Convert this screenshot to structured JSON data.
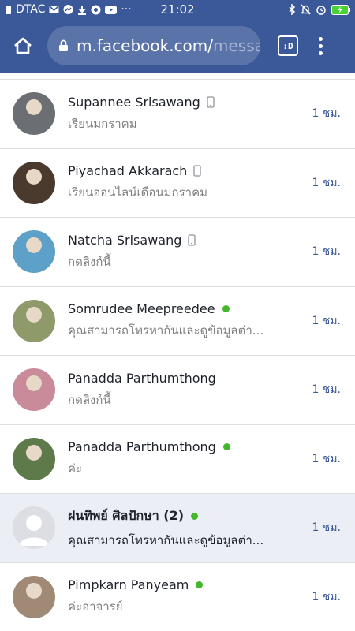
{
  "status_bar": {
    "carrier": "DTAC",
    "time": "21:02",
    "icons": [
      "sim-icon",
      "gmail-icon",
      "messenger-icon",
      "download-icon",
      "shield-icon",
      "youtube-icon",
      "more-icon",
      "bluetooth-icon",
      "mute-icon",
      "alarm-icon",
      "battery-charging-icon"
    ],
    "more": "···"
  },
  "browser": {
    "url_main": "m.facebook.com/",
    "url_faded": "messa",
    "tab_label": ":D"
  },
  "conversations": [
    {
      "name": "Supannee Srisawang",
      "indicator": "phone",
      "snippet": "เรียนมกราคม",
      "time": "1 ชม.",
      "unread": false,
      "avatar_color": "#6b6f73"
    },
    {
      "name": "Piyachad Akkarach",
      "indicator": "phone",
      "snippet": "เรียนออนไลน์เดือนมกราคม",
      "time": "1 ชม.",
      "unread": false,
      "avatar_color": "#4a3a2e"
    },
    {
      "name": "Natcha Srisawang",
      "indicator": "phone",
      "snippet": "กดลิงก์นี้",
      "time": "1 ชม.",
      "unread": false,
      "avatar_color": "#5da0c8"
    },
    {
      "name": "Somrudee Meepreedee",
      "indicator": "online",
      "snippet": "คุณสามารถโทรหากันและดูข้อมูลต่า...",
      "time": "1 ชม.",
      "unread": false,
      "avatar_color": "#8f9a6a"
    },
    {
      "name": "Panadda Parthumthong",
      "indicator": "none",
      "snippet": "กดลิงก์นี้",
      "time": "1 ชม.",
      "unread": false,
      "avatar_color": "#c98a9a"
    },
    {
      "name": "Panadda Parthumthong",
      "indicator": "online",
      "snippet": "ค่ะ",
      "time": "1 ชม.",
      "unread": false,
      "avatar_color": "#5e7a4a"
    },
    {
      "name": "ฝนทิพย์ ศิลปักษา (2)",
      "indicator": "online",
      "snippet": "คุณสามารถโทรหากันและดูข้อมูลต่า...",
      "time": "1 ชม.",
      "unread": true,
      "avatar_color": "#dcdee3"
    },
    {
      "name": "Pimpkarn Panyeam",
      "indicator": "online",
      "snippet": "ค่ะอาจารย์",
      "time": "1 ชม.",
      "unread": false,
      "avatar_color": "#a08a76"
    }
  ]
}
